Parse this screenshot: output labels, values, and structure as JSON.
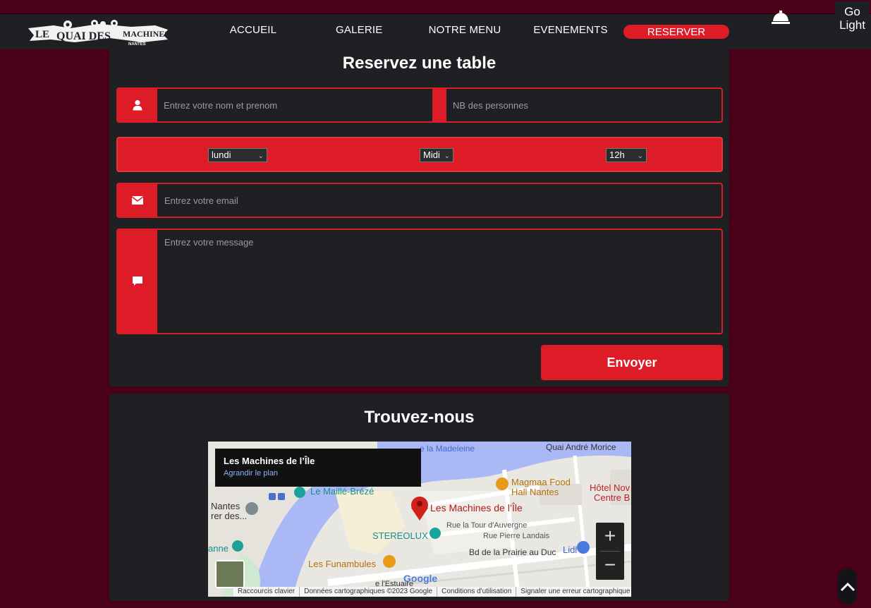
{
  "colors": {
    "accent": "#dd1c27",
    "page_bg": "#4a0019",
    "panel_bg": "#1f2024"
  },
  "brand": {
    "logo_text_main": "LE QUAI DES MACHINES",
    "logo_text_sub": "NANTES"
  },
  "nav": {
    "items": [
      {
        "label": "ACCUEIL"
      },
      {
        "label": "GALERIE"
      },
      {
        "label": "NOTRE MENU"
      },
      {
        "label": "EVENEMENTS"
      }
    ],
    "reserve_label": "RESERVER",
    "icon": "service-bell-icon"
  },
  "theme_toggle": {
    "line1": "Go",
    "line2": "Light"
  },
  "reservation": {
    "title": "Reservez une table",
    "name_placeholder": "Entrez votre nom et prenom",
    "people_placeholder": "NB des personnes",
    "day_value": "lundi",
    "meal_value": "Midi",
    "time_value": "12h",
    "email_placeholder": "Entrez votre email",
    "message_placeholder": "Entrez votre message",
    "submit_label": "Envoyer"
  },
  "find_us": {
    "title": "Trouvez-nous",
    "map": {
      "place_name": "Les Machines de l’Île",
      "enlarge_link": "Agrandir le plan",
      "labels": {
        "madeleine": "e la Madeleine",
        "quai": "Quai André Morice",
        "magmaa1": "Magmaa Food",
        "magmaa2": "Hall Nantes",
        "hotel1": "Hôtel Nov",
        "hotel2": "Centre B",
        "maille": "Le Maillé-Brézé",
        "nantes1": "Nantes",
        "nantes2": "rer des...",
        "machines": "Les Machines de l’Île",
        "tour": "Rue la Tour d'Auvergne",
        "landais": "Rue Pierre Landais",
        "stereolux": "STEREOLUX",
        "prairie": "Bd de la Prairie au Duc",
        "lidl": "Lidl",
        "anne": "anne",
        "funambules": "Les Funambules",
        "estuaire": "e l'Estuaire",
        "google": "Google"
      },
      "zoom_in": "+",
      "zoom_out": "−",
      "footer": [
        "Raccourcis clavier",
        "Données cartographiques ©2023 Google",
        "Conditions d'utilisation",
        "Signaler une erreur cartographique"
      ]
    }
  }
}
